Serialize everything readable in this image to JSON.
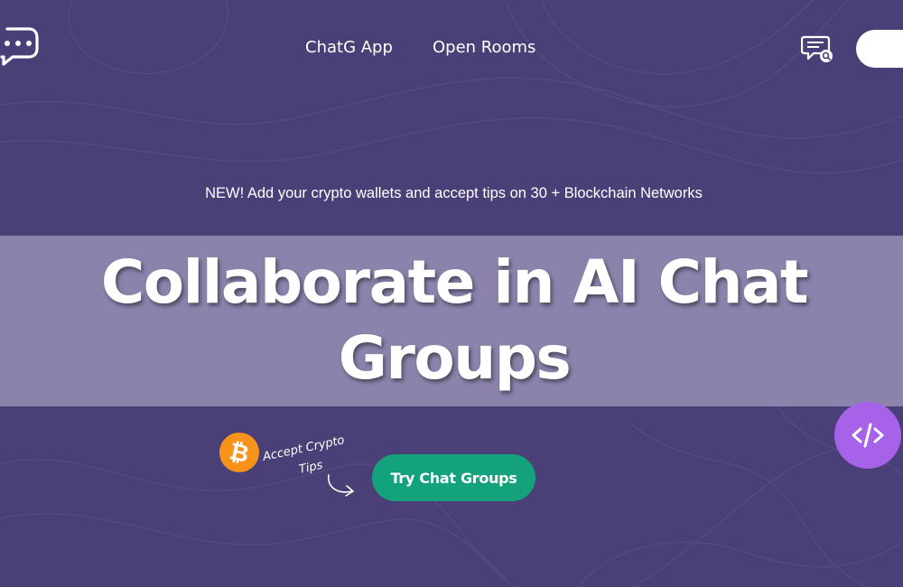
{
  "header": {
    "logo_icon": "chat-bubble-logo-icon",
    "nav_items": [
      {
        "label": "ChatG App"
      },
      {
        "label": "Open Rooms"
      }
    ],
    "chat_search_icon": "chat-search-icon"
  },
  "hero": {
    "announcement": "NEW! Add your crypto wallets and accept tips on 30 + Blockchain Networks",
    "title_line1": "Collaborate in AI Chat",
    "title_line2": "Groups",
    "crypto_note_line1": "Accept Crypto",
    "crypto_note_line2": "Tips",
    "cta_label": "Try Chat Groups",
    "bitcoin_icon": "bitcoin-icon"
  },
  "floating": {
    "code_icon": "code-icon"
  },
  "colors": {
    "background": "#4a4077",
    "hero_band": "#8b83ab",
    "cta": "#14a27c",
    "bitcoin": "#f7931a",
    "fab": "#a662e8"
  }
}
